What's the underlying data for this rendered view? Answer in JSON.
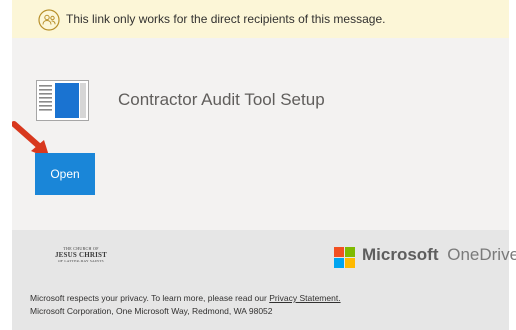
{
  "notice": {
    "text": "This link only works for the direct recipients of this message.",
    "icon": "restricted-people-icon",
    "background": "#fcf6d7"
  },
  "file": {
    "name": "Contractor Audit Tool Setup",
    "icon": "document-icon"
  },
  "open_button": {
    "label": "Open",
    "color": "#1a86d8"
  },
  "footer": {
    "church_logo": {
      "line1": "THE CHURCH OF",
      "line2": "JESUS CHRIST",
      "line3": "OF LATTER-DAY SAINTS"
    },
    "brand": "Microsoft",
    "product": "OneDrive",
    "privacy_text": "Microsoft respects your privacy. To learn more, please read our",
    "privacy_link": "Privacy Statement.",
    "address": "Microsoft Corporation, One Microsoft Way, Redmond, WA 98052"
  }
}
